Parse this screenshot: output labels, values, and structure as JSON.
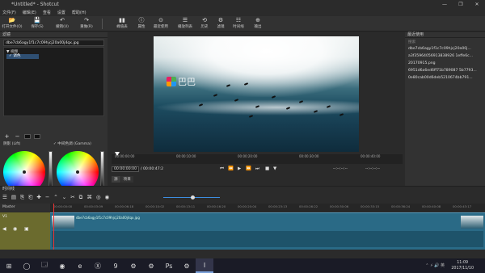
{
  "window": {
    "title": "*Untitled* - Shotcut",
    "controls": [
      "—",
      "❐",
      "✕"
    ]
  },
  "menu": [
    "文件(F)",
    "编辑(E)",
    "查看",
    "设置",
    "帮助(H)"
  ],
  "toolbar": [
    {
      "icon": "folder-open-icon",
      "glyph": "📂",
      "label": "打开文件(O)"
    },
    {
      "icon": "save-icon",
      "glyph": "💾",
      "label": "保存(S)"
    },
    {
      "icon": "undo-icon",
      "glyph": "↶",
      "label": "撤销(U)"
    },
    {
      "icon": "redo-icon",
      "glyph": "↷",
      "label": "重做(R)"
    },
    {
      "icon": "peak-meter-icon",
      "glyph": "▮▮",
      "label": "峰值表"
    },
    {
      "icon": "properties-icon",
      "glyph": "ⓘ",
      "label": "属性"
    },
    {
      "icon": "recent-icon",
      "glyph": "⊙",
      "label": "最近使用"
    },
    {
      "icon": "playlist-icon",
      "glyph": "☰",
      "label": "播放列表"
    },
    {
      "icon": "history-icon",
      "glyph": "⟲",
      "label": "历史"
    },
    {
      "icon": "filters-icon",
      "glyph": "⚙",
      "label": "滤镜"
    },
    {
      "icon": "timeline-icon",
      "glyph": "☷",
      "label": "时间线"
    },
    {
      "icon": "export-icon",
      "glyph": "⊕",
      "label": "输出"
    }
  ],
  "filters": {
    "header": "滤镜",
    "file": "dbe7cb6agy1f1c7c09hjcj20a00j4qx.jpg",
    "category": "▼ 视频",
    "selected": "✓ 调色",
    "tools": [
      "+",
      "−",
      "■",
      "▣"
    ]
  },
  "color": {
    "lift_label": "阴影 (Lift)",
    "gain_label": "✓ 中间色调 (Gamma)"
  },
  "left_tabs": [
    "播放列表",
    "滤镜"
  ],
  "viewer": {
    "watermark": "巴巴",
    "ruler_ticks": [
      "00:00:00:00",
      "00:00:10:00",
      "00:00:20:00",
      "00:00:30:00",
      "00:00:40:00"
    ],
    "timecode": "00:00:00:00",
    "duration": "/ 00:00:47:2",
    "right_tc_a": "--:--:--:--",
    "right_tc_b": "--:--:--:--",
    "transport": [
      "⏮",
      "⏪",
      "▶",
      "⏩",
      "⏭",
      "■",
      "▼"
    ],
    "source_tabs": [
      "源",
      "项目"
    ]
  },
  "recent": {
    "header": "最近使用",
    "placeholder": "搜索",
    "files": [
      "dbe7cb6agy1f1c7c09hjcj20a00j...",
      "a3f35964056913838926 1effe6c...",
      "20170915.png",
      "6951d6a6ed6ff71b789087 5b7793...",
      "0e80cab00d6deb5210674bb791..."
    ]
  },
  "timeline": {
    "header": "时间线",
    "tools": [
      "☰",
      "▤",
      "⎘",
      "⎗",
      "✚",
      "−",
      "⌃",
      "⌄",
      "✂",
      "⧉",
      "⌘",
      "◎",
      "◉"
    ],
    "master": "Master",
    "track": "V1",
    "ticks": [
      "00:00:00:00",
      "00:00:03:09",
      "00:00:06:18",
      "00:00:10:02",
      "00:00:13:11",
      "00:00:16:20",
      "00:00:20:04",
      "00:00:23:13",
      "00:00:26:22",
      "00:00:30:06",
      "00:00:33:15",
      "00:00:36:24",
      "00:00:40:08",
      "00:00:43:17"
    ],
    "clip_name": "dbe7cb6agy1f1c7c09hjcj20a00j4qx.jpg"
  },
  "taskbar": {
    "icons": [
      "⊞",
      "◯",
      "🗔",
      "◉",
      "e",
      "Ⓧ",
      "9",
      "⚙",
      "⚙",
      "Ps",
      "⚙",
      "I"
    ],
    "time": "11:09",
    "date": "2017/11/10",
    "tray": "⌃ ⚡ 🔊 英"
  },
  "colors": {
    "accent": "#3d8ee0",
    "track_head": "#6b6b2e",
    "clip": "#2a6a86",
    "playhead": "#ee3333"
  }
}
